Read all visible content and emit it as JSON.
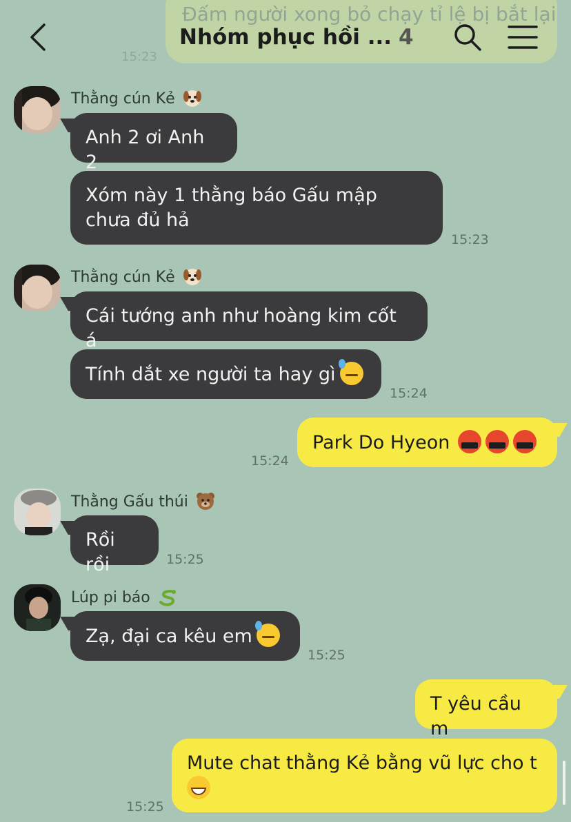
{
  "header": {
    "title": "Nhóm phục hồi ...",
    "member_count": "4",
    "ghost_message": "Đấm người xong bỏ chạy tỉ lệ bị bắt lại",
    "ghost_time": "15:23"
  },
  "messages": {
    "m1_sender": "Thằng cún Kẻ",
    "m1_text1": "Anh 2 ơi Anh 2",
    "m1_text2": "Xóm này 1 thằng báo Gấu mập chưa đủ hả",
    "m1_time": "15:23",
    "m2_sender": "Thằng cún Kẻ",
    "m2_text1": "Cái tướng anh như hoàng kim cốt á",
    "m2_text2": "Tính dắt xe người ta hay gì",
    "m2_time": "15:24",
    "m3_text": "Park Do Hyeon",
    "m3_time": "15:24",
    "m4_sender": "Thằng Gấu thúi",
    "m4_text": "Rồi rồi",
    "m4_time": "15:25",
    "m5_sender": "Lúp pi báo",
    "m5_text": "Zạ, đại ca kêu em",
    "m5_time": "15:25",
    "m6_text": "T yêu cầu m",
    "m7_text": "Mute chat thằng Kẻ bằng vũ lực cho t",
    "m7_time": "15:25"
  },
  "icons": {
    "back": "chevron-left-icon",
    "search": "search-icon",
    "menu": "hamburger-menu-icon",
    "dog": "dog-face-emoji",
    "bear": "bear-face-emoji",
    "snake": "snake-emoji",
    "sweat": "downcast-sweat-emoji",
    "cursing": "cursing-face-emoji",
    "grin": "grinning-face-emoji"
  },
  "colors": {
    "background": "#a8c5b5",
    "incoming_bubble": "#3b3b3d",
    "outgoing_bubble": "#f8ea45"
  }
}
